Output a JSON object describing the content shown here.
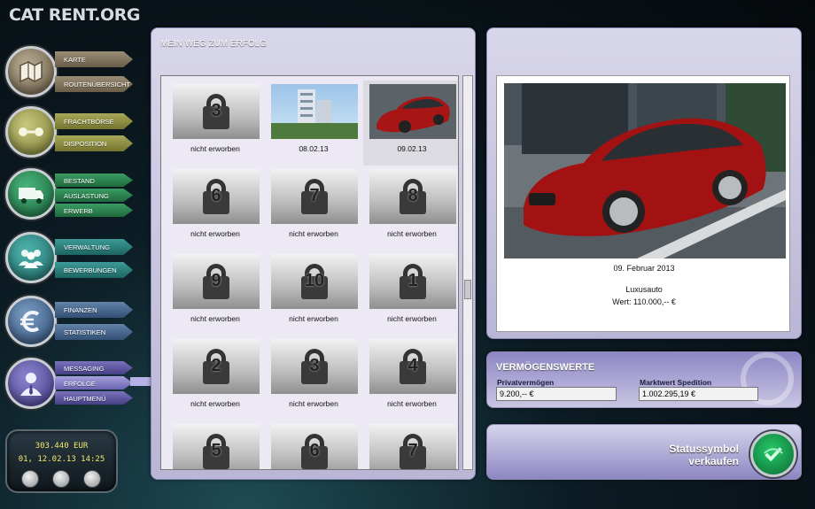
{
  "app": {
    "logo": "CAT RENT.ORG"
  },
  "nav": {
    "karte": "KARTE",
    "routenuebersicht": "ROUTENÜBERSICHT",
    "frachtboerse": "FRACHTBÖRSE",
    "disposition": "DISPOSITION",
    "bestand": "BESTAND",
    "auslastung": "AUSLASTUNG",
    "erwerb": "ERWERB",
    "verwaltung": "VERWALTUNG",
    "bewerbungen": "BEWERBUNGEN",
    "finanzen": "FINANZEN",
    "statistiken": "STATISTIKEN",
    "messaging": "MESSAGING",
    "erfolge": "ERFOLGE",
    "hauptmenu": "HAUPTMENÜ",
    "active": "ERFOLGE"
  },
  "status": {
    "money": "303.440 EUR",
    "datetime": "01, 12.02.13 14:25"
  },
  "achievements": {
    "title": "MEIN WEG ZUM ERFOLG",
    "tiles": [
      {
        "number": "3",
        "label": "nicht erworben",
        "image": "lock-icon"
      },
      {
        "number": "",
        "label": "08.02.13",
        "image": "office-building-photo"
      },
      {
        "number": "",
        "label": "09.02.13",
        "image": "red-sports-car-photo",
        "selected": true
      },
      {
        "number": "6",
        "label": "nicht erworben",
        "image": "lock-icon"
      },
      {
        "number": "7",
        "label": "nicht erworben",
        "image": "lock-icon"
      },
      {
        "number": "8",
        "label": "nicht erworben",
        "image": "lock-icon"
      },
      {
        "number": "9",
        "label": "nicht erworben",
        "image": "lock-icon"
      },
      {
        "number": "10",
        "label": "nicht erworben",
        "image": "lock-icon"
      },
      {
        "number": "1",
        "label": "nicht erworben",
        "image": "lock-icon"
      },
      {
        "number": "2",
        "label": "nicht erworben",
        "image": "lock-icon"
      },
      {
        "number": "3",
        "label": "nicht erworben",
        "image": "lock-icon"
      },
      {
        "number": "4",
        "label": "nicht erworben",
        "image": "lock-icon"
      },
      {
        "number": "5",
        "label": "",
        "image": "lock-icon"
      },
      {
        "number": "6",
        "label": "",
        "image": "lock-icon"
      },
      {
        "number": "7",
        "label": "",
        "image": "lock-icon"
      }
    ]
  },
  "detail": {
    "image": "red-sports-car-photo",
    "date": "09. Februar 2013",
    "name": "Luxusauto",
    "value": "Wert: 110.000,-- €"
  },
  "assets": {
    "title": "VERMÖGENSWERTE",
    "private_label": "Privatvermögen",
    "private_value": "9.200,-- €",
    "market_label": "Marktwert Spedition",
    "market_value": "1.002.295,19 €"
  },
  "sell": {
    "label_line1": "Statussymbol",
    "label_line2": "verkaufen"
  },
  "colors": {
    "panel": "#c9c6e0",
    "accent": "#7a72bb",
    "money_text": "#f3e96a",
    "sell_button": "#1a9a4f"
  }
}
